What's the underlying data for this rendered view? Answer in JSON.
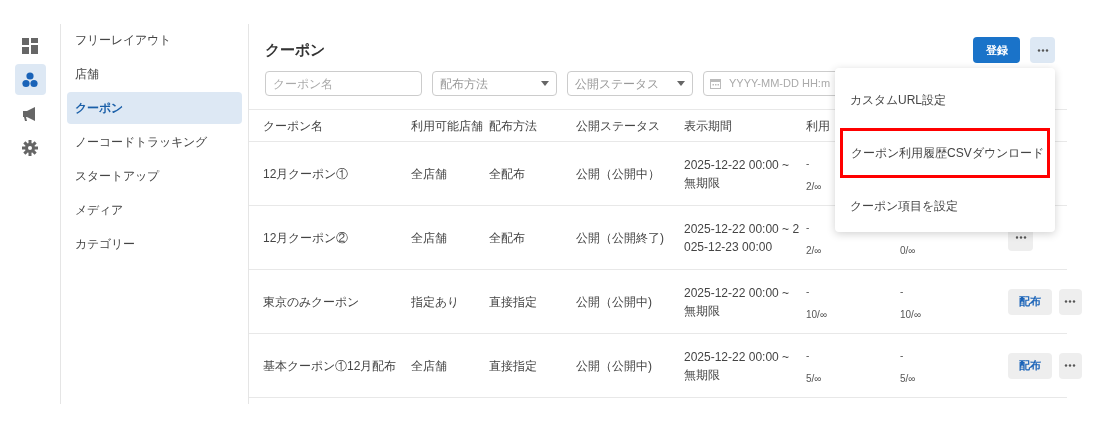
{
  "rail": [
    {
      "selected": false
    },
    {
      "selected": true
    },
    {
      "selected": false
    },
    {
      "selected": false
    }
  ],
  "sidebar": {
    "items": [
      {
        "label": "フリーレイアウト",
        "selected": false
      },
      {
        "label": "店舗",
        "selected": false
      },
      {
        "label": "クーポン",
        "selected": true
      },
      {
        "label": "ノーコードトラッキング",
        "selected": false
      },
      {
        "label": "スタートアップ",
        "selected": false
      },
      {
        "label": "メディア",
        "selected": false
      },
      {
        "label": "カテゴリー",
        "selected": false
      }
    ]
  },
  "page_title": "クーポン",
  "register_button": "登録",
  "filters": {
    "name": {
      "placeholder": "クーポン名"
    },
    "method": {
      "placeholder": "配布方法"
    },
    "status": {
      "placeholder": "公開ステータス"
    },
    "date": {
      "placeholder": "YYYY-MM-DD HH:m"
    }
  },
  "table": {
    "columns": [
      "クーポン名",
      "利用可能店舗",
      "配布方法",
      "公開ステータス",
      "表示期間",
      "利用"
    ],
    "rows": [
      {
        "name": "12月クーポン①",
        "stores": "全店舗",
        "method": "全配布",
        "status": "公開（公開中）",
        "period": [
          "2025-12-22 00:00 ~",
          "無期限"
        ],
        "usage_1": [
          "-",
          "2/∞"
        ],
        "more": false
      },
      {
        "name": "12月クーポン②",
        "stores": "全店舗",
        "method": "全配布",
        "status": "公開（公開終了)",
        "period": [
          "2025-12-22 00:00 ~ 2",
          "025-12-23 00:00"
        ],
        "usage_1": [
          "-",
          "2/∞"
        ],
        "usage_2": [
          "0/∞"
        ],
        "more": true
      },
      {
        "name": "東京のみクーポン",
        "stores": "指定あり",
        "method": "直接指定",
        "status": "公開（公開中)",
        "period": [
          "2025-12-22 00:00 ~",
          "無期限"
        ],
        "usage_1": [
          "-",
          "10/∞"
        ],
        "usage_2": [
          "-",
          "10/∞"
        ],
        "distribute": "配布",
        "more": true
      },
      {
        "name": "基本クーポン①12月配布",
        "stores": "全店舗",
        "method": "直接指定",
        "status": "公開（公開中)",
        "period": [
          "2025-12-22 00:00 ~",
          "無期限"
        ],
        "usage_1": [
          "-",
          "5/∞"
        ],
        "usage_2": [
          "-",
          "5/∞"
        ],
        "distribute": "配布",
        "more": true
      }
    ]
  },
  "menu": {
    "items": [
      {
        "label": "カスタムURL設定",
        "highlighted": false
      },
      {
        "label": "クーポン利用履歴CSVダウンロード",
        "highlighted": true
      },
      {
        "label": "クーポン項目を設定",
        "highlighted": false
      }
    ]
  }
}
